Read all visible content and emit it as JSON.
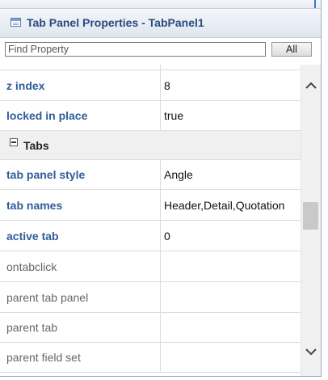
{
  "panel": {
    "title": "Tab Panel Properties - TabPanel1"
  },
  "search": {
    "placeholder": "Find Property",
    "all_label": "All"
  },
  "properties": {
    "z_index": {
      "name": "z index",
      "value": "8"
    },
    "locked": {
      "name": "locked in place",
      "value": "true"
    },
    "tabs_group": {
      "label": "Tabs"
    },
    "tab_panel_style": {
      "name": "tab panel style",
      "value": "Angle"
    },
    "tab_names": {
      "name": "tab names",
      "value": "Header,Detail,Quotation"
    },
    "active_tab": {
      "name": "active tab",
      "value": "0"
    },
    "ontabclick": {
      "name": "ontabclick",
      "value": ""
    },
    "parent_tab_panel": {
      "name": "parent tab panel",
      "value": ""
    },
    "parent_tab": {
      "name": "parent tab",
      "value": ""
    },
    "parent_field_set": {
      "name": "parent field set",
      "value": ""
    }
  },
  "icons": {
    "title": "panel-icon",
    "group_toggle": "collapse-box-icon",
    "scroll_up": "chevron-up-icon",
    "scroll_down": "chevron-down-icon"
  },
  "colors": {
    "title_text": "#2a4a80",
    "property_name": "#2f5d9a",
    "plain_property_name": "#666666",
    "group_background": "#f0f0f0"
  }
}
